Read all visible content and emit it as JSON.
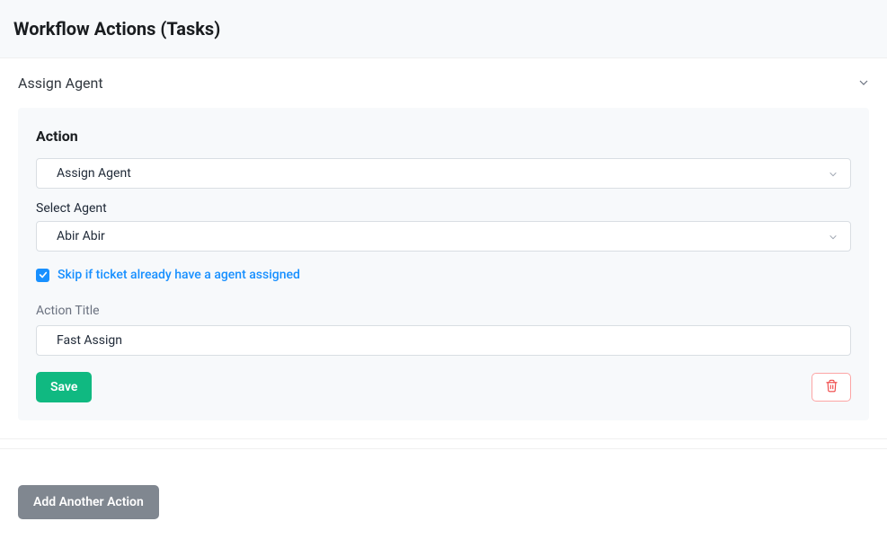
{
  "header": {
    "title": "Workflow Actions (Tasks)"
  },
  "accordion": {
    "title": "Assign Agent"
  },
  "panel": {
    "section_title": "Action",
    "action_select": {
      "value": "Assign Agent"
    },
    "agent_label": "Select Agent",
    "agent_select": {
      "value": "Abir Abir"
    },
    "skip_checkbox": {
      "checked": true,
      "label": "Skip if ticket already have a agent assigned"
    },
    "title_label": "Action Title",
    "title_input": {
      "value": "Fast Assign"
    },
    "save_label": "Save"
  },
  "footer": {
    "add_label": "Add Another Action"
  }
}
